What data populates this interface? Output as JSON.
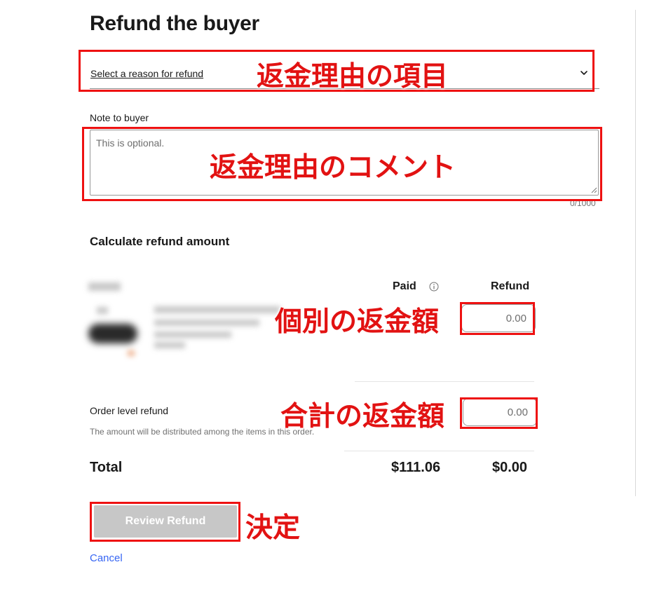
{
  "page": {
    "title": "Refund the buyer"
  },
  "reason_select": {
    "label": "Select a reason for refund",
    "icon": "chevron-down-icon"
  },
  "note": {
    "label": "Note to buyer",
    "placeholder": "This is optional.",
    "char_count": "0/1000"
  },
  "calculate": {
    "title": "Calculate refund amount",
    "col_paid": "Paid",
    "col_refund": "Refund",
    "paid_info_icon": "info-icon"
  },
  "item": {
    "refund_value": "0.00"
  },
  "order_level": {
    "label": "Order level refund",
    "hint": "The amount will be distributed among the items in this order.",
    "refund_value": "0.00"
  },
  "total": {
    "label": "Total",
    "paid": "$111.06",
    "refund": "$0.00"
  },
  "actions": {
    "review_label": "Review Refund",
    "cancel_label": "Cancel"
  },
  "annotations": {
    "reason": "返金理由の項目",
    "comment": "返金理由のコメント",
    "item_refund": "個別の返金額",
    "total_refund": "合計の返金額",
    "decide": "決定"
  },
  "colors": {
    "annotation_red": "#e21212",
    "link_blue": "#3665f3",
    "disabled_button": "#c7c7c7"
  }
}
